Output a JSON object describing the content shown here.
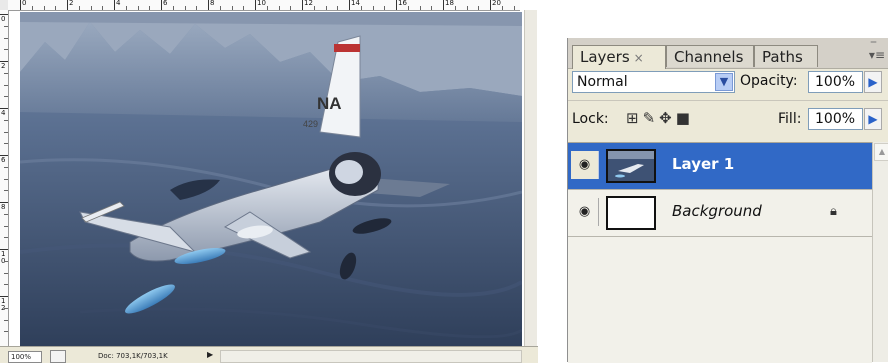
{
  "document": {
    "ruler_h_numbers": [
      "0",
      "2",
      "4",
      "6",
      "8",
      "10",
      "12",
      "14",
      "16",
      "18",
      "20"
    ],
    "ruler_v_numbers": [
      "0",
      "2",
      "4",
      "6",
      "8",
      "1\n0",
      "1\n2",
      "1\n4"
    ],
    "status": {
      "zoom": "100%",
      "doc_info": "Doc: 703,1K/703,1K",
      "menu_arrow": "▶"
    },
    "image": {
      "tail_code": "NA",
      "tail_number": "429"
    }
  },
  "layers_panel": {
    "tabs": [
      {
        "label": "Layers",
        "close": "×",
        "active": true
      },
      {
        "label": "Channels",
        "active": false
      },
      {
        "label": "Paths",
        "active": false
      }
    ],
    "blend_mode": "Normal",
    "opacity_label": "Opacity:",
    "opacity_value": "100%",
    "lock_label": "Lock:",
    "fill_label": "Fill:",
    "fill_value": "100%",
    "layers": [
      {
        "name": "Layer 1",
        "selected": true,
        "visible": true,
        "locked": false
      },
      {
        "name": "Background",
        "selected": false,
        "visible": true,
        "locked": true
      }
    ]
  },
  "colors": {
    "selection": "#3169c6",
    "panel_bg": "#ece9d8",
    "sky": "#5f7596"
  }
}
